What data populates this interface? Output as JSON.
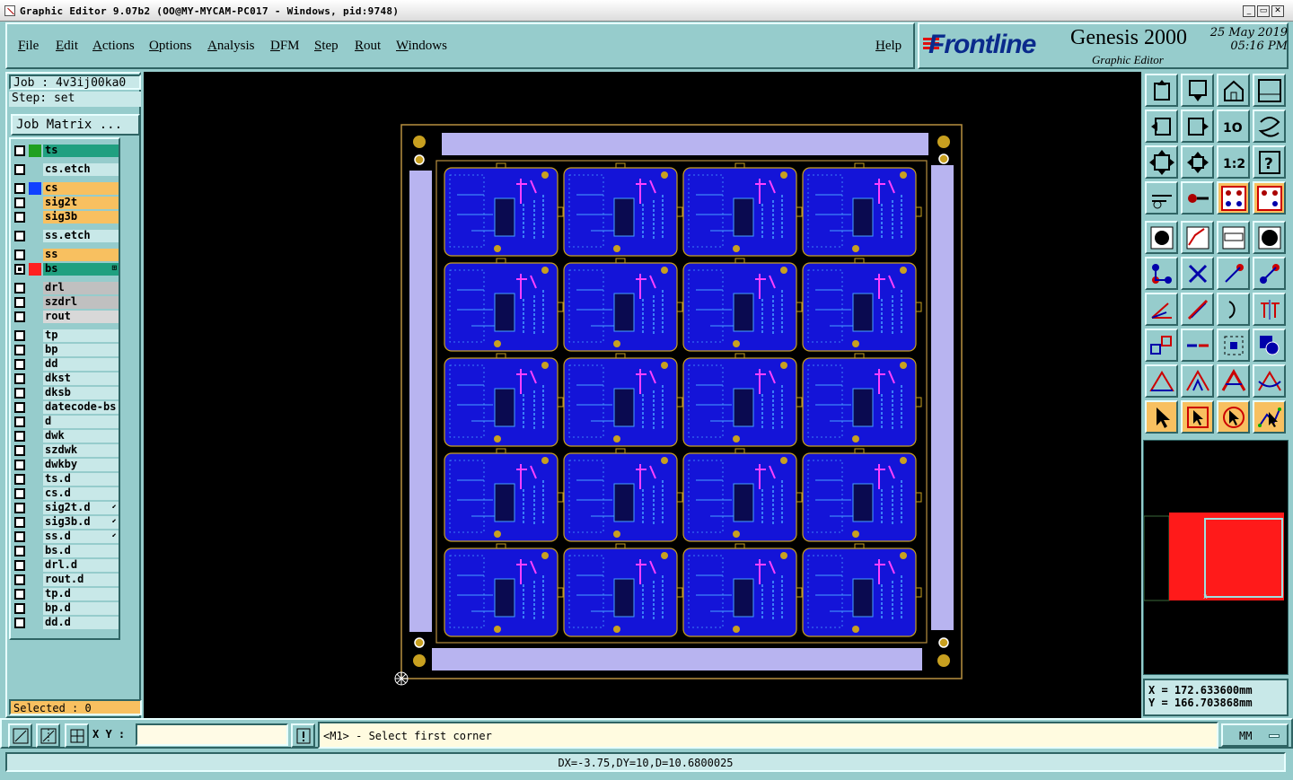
{
  "window": {
    "title": "Graphic Editor 9.07b2 (OO@MY-MYCAM-PC017 - Windows, pid:9748)",
    "controls": [
      "_",
      "▭",
      "✕"
    ]
  },
  "menu": [
    "File",
    "Edit",
    "Actions",
    "Options",
    "Analysis",
    "DFM",
    "Step",
    "Rout",
    "Windows"
  ],
  "help": "Help",
  "brand": {
    "logo": "Frontline",
    "product": "Genesis 2000",
    "subtitle": "Graphic Editor",
    "date": "25 May 2019",
    "time": "05:16 PM"
  },
  "job": {
    "job_label": "Job : 4v3ij00ka0",
    "step_label": "Step: set",
    "matrix_button": "Job Matrix ..."
  },
  "layers": [
    {
      "name": "ts",
      "color": "#20a080",
      "swatch": "#20a020",
      "checked": false,
      "group": 0
    },
    {
      "name": "cs.etch",
      "color": "#c8e8e8",
      "swatch": "",
      "checked": false,
      "group": 1
    },
    {
      "name": "cs",
      "color": "#f8c060",
      "swatch": "#1040ff",
      "checked": false,
      "group": 2
    },
    {
      "name": "sig2t",
      "color": "#f8c060",
      "swatch": "",
      "checked": false,
      "group": 2
    },
    {
      "name": "sig3b",
      "color": "#f8c060",
      "swatch": "",
      "checked": false,
      "group": 2
    },
    {
      "name": "ss.etch",
      "color": "#c8e8e8",
      "swatch": "",
      "checked": false,
      "group": 3
    },
    {
      "name": "ss",
      "color": "#f8c060",
      "swatch": "",
      "checked": false,
      "group": 4
    },
    {
      "name": "bs",
      "color": "#20a080",
      "swatch": "#ff2020",
      "checked": true,
      "group": 4,
      "mark": "⊞"
    },
    {
      "name": "drl",
      "color": "#c0c0c0",
      "swatch": "",
      "checked": false,
      "group": 5
    },
    {
      "name": "szdrl",
      "color": "#c0c0c0",
      "swatch": "",
      "checked": false,
      "group": 5
    },
    {
      "name": "rout",
      "color": "#d8d8d8",
      "swatch": "",
      "checked": false,
      "group": 5
    },
    {
      "name": "tp",
      "color": "#c8e8e8",
      "swatch": "",
      "checked": false,
      "group": 6
    },
    {
      "name": "bp",
      "color": "#c8e8e8",
      "swatch": "",
      "checked": false,
      "group": 6
    },
    {
      "name": "dd",
      "color": "#c8e8e8",
      "swatch": "",
      "checked": false,
      "group": 6
    },
    {
      "name": "dkst",
      "color": "#c8e8e8",
      "swatch": "",
      "checked": false,
      "group": 6
    },
    {
      "name": "dksb",
      "color": "#c8e8e8",
      "swatch": "",
      "checked": false,
      "group": 6
    },
    {
      "name": "datecode-bs",
      "color": "#c8e8e8",
      "swatch": "",
      "checked": false,
      "group": 6
    },
    {
      "name": "d",
      "color": "#c8e8e8",
      "swatch": "",
      "checked": false,
      "group": 6
    },
    {
      "name": "dwk",
      "color": "#c8e8e8",
      "swatch": "",
      "checked": false,
      "group": 6
    },
    {
      "name": "szdwk",
      "color": "#c8e8e8",
      "swatch": "",
      "checked": false,
      "group": 6
    },
    {
      "name": "dwkby",
      "color": "#c8e8e8",
      "swatch": "",
      "checked": false,
      "group": 6
    },
    {
      "name": "ts.d",
      "color": "#c8e8e8",
      "swatch": "",
      "checked": false,
      "group": 6
    },
    {
      "name": "cs.d",
      "color": "#c8e8e8",
      "swatch": "",
      "checked": false,
      "group": 6
    },
    {
      "name": "sig2t.d",
      "color": "#c8e8e8",
      "swatch": "",
      "checked": false,
      "group": 6,
      "mark": "⬋"
    },
    {
      "name": "sig3b.d",
      "color": "#c8e8e8",
      "swatch": "",
      "checked": false,
      "group": 6,
      "mark": "⬋"
    },
    {
      "name": "ss.d",
      "color": "#c8e8e8",
      "swatch": "",
      "checked": false,
      "group": 6,
      "mark": "⬋"
    },
    {
      "name": "bs.d",
      "color": "#c8e8e8",
      "swatch": "",
      "checked": false,
      "group": 6
    },
    {
      "name": "drl.d",
      "color": "#c8e8e8",
      "swatch": "",
      "checked": false,
      "group": 6
    },
    {
      "name": "rout.d",
      "color": "#c8e8e8",
      "swatch": "",
      "checked": false,
      "group": 6
    },
    {
      "name": "tp.d",
      "color": "#c8e8e8",
      "swatch": "",
      "checked": false,
      "group": 6
    },
    {
      "name": "bp.d",
      "color": "#c8e8e8",
      "swatch": "",
      "checked": false,
      "group": 6
    },
    {
      "name": "dd.d",
      "color": "#c8e8e8",
      "swatch": "",
      "checked": false,
      "group": 6
    }
  ],
  "selected_label": "Selected : 0",
  "tools": [
    {
      "icon": "zoom-home-icon",
      "hl": false
    },
    {
      "icon": "zoom-down-icon",
      "hl": false
    },
    {
      "icon": "home-icon",
      "hl": false
    },
    {
      "icon": "window-xy-icon",
      "hl": false
    },
    {
      "icon": "pan-left-icon",
      "hl": false
    },
    {
      "icon": "pan-right-icon",
      "hl": false
    },
    {
      "icon": "one-to-one-icon",
      "hl": false
    },
    {
      "icon": "snap-icon",
      "hl": false
    },
    {
      "icon": "fit-screen-icon",
      "hl": false
    },
    {
      "icon": "fit-zoom-icon",
      "hl": false
    },
    {
      "icon": "ratio-icon",
      "hl": false
    },
    {
      "icon": "help-query-icon",
      "hl": false
    },
    {
      "icon": "ruler-icon",
      "hl": false
    },
    {
      "icon": "key-icon",
      "hl": false
    },
    {
      "icon": "netlist-icon",
      "hl": true
    },
    {
      "icon": "netlist-compare-icon",
      "hl": true
    },
    {
      "icon": "pad-icon",
      "hl": false
    },
    {
      "icon": "line-icon",
      "hl": false
    },
    {
      "icon": "measure-icon",
      "hl": false
    },
    {
      "icon": "record-icon",
      "hl": false
    },
    {
      "icon": "node-icon",
      "hl": false
    },
    {
      "icon": "cross-icon",
      "hl": false
    },
    {
      "icon": "connect-icon",
      "hl": false
    },
    {
      "icon": "connect2-icon",
      "hl": false
    },
    {
      "icon": "angle-icon",
      "hl": false
    },
    {
      "icon": "slope-icon",
      "hl": false
    },
    {
      "icon": "arc-icon",
      "hl": false
    },
    {
      "icon": "text-icon",
      "hl": false
    },
    {
      "icon": "move-icon",
      "hl": false
    },
    {
      "icon": "dash-icon",
      "hl": false
    },
    {
      "icon": "array-icon",
      "hl": false
    },
    {
      "icon": "copy-icon",
      "hl": false
    },
    {
      "icon": "poly-icon",
      "hl": false
    },
    {
      "icon": "poly2-icon",
      "hl": false
    },
    {
      "icon": "poly3-icon",
      "hl": false
    },
    {
      "icon": "poly4-icon",
      "hl": false
    },
    {
      "icon": "pointer-icon",
      "hl": true
    },
    {
      "icon": "pointer-box-icon",
      "hl": true
    },
    {
      "icon": "pointer-circle-icon",
      "hl": true
    },
    {
      "icon": "pointer-net-icon",
      "hl": true
    }
  ],
  "coords": {
    "x": "X = 172.633600mm",
    "y": "Y = 166.703868mm"
  },
  "bottom": {
    "xy_label": "X Y :",
    "xy_value": "",
    "prompt": "<M1> - Select first corner",
    "unit": "MM"
  },
  "status": "DX=-3.75,DY=10,D=10.6800025",
  "panel_grid": {
    "rows": 5,
    "cols": 4
  }
}
